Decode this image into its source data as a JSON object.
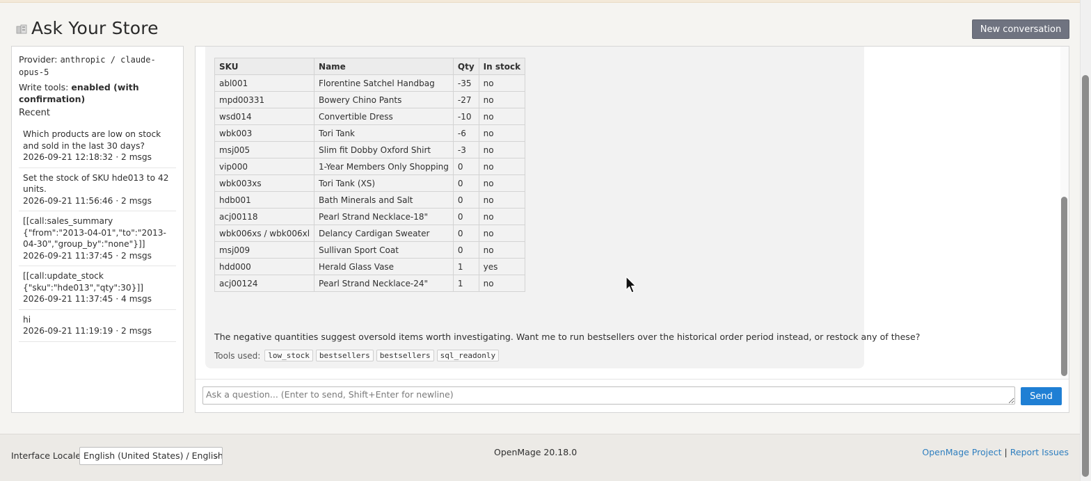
{
  "header": {
    "title": "Ask Your Store",
    "new_conversation_label": "New conversation"
  },
  "sidebar": {
    "provider_label": "Provider:",
    "provider_value": "anthropic / claude-opus-5",
    "write_label": "Write tools:",
    "write_value": "enabled (with confirmation)",
    "recent_heading": "Recent",
    "recent": [
      {
        "question": "Which products are low on stock and sold in the last 30 days?",
        "meta": "2026-09-21 12:18:32 · 2 msgs"
      },
      {
        "question": "Set the stock of SKU hde013 to 42 units.",
        "meta": "2026-09-21 11:56:46 · 2 msgs"
      },
      {
        "question": "[[call:sales_summary {\"from\":\"2013-04-01\",\"to\":\"2013-04-30\",\"group_by\":\"none\"}]]",
        "meta": "2026-09-21 11:37:45 · 2 msgs"
      },
      {
        "question": "[[call:update_stock {\"sku\":\"hde013\",\"qty\":30}]]",
        "meta": "2026-09-21 11:37:45 · 4 msgs"
      },
      {
        "question": "hi",
        "meta": "2026-09-21 11:19:19 · 2 msgs"
      }
    ]
  },
  "chat": {
    "table": {
      "headers": [
        "SKU",
        "Name",
        "Qty",
        "In stock"
      ],
      "rows": [
        [
          "abl001",
          "Florentine Satchel Handbag",
          "-35",
          "no"
        ],
        [
          "mpd00331",
          "Bowery Chino Pants",
          "-27",
          "no"
        ],
        [
          "wsd014",
          "Convertible Dress",
          "-10",
          "no"
        ],
        [
          "wbk003",
          "Tori Tank",
          "-6",
          "no"
        ],
        [
          "msj005",
          "Slim fit Dobby Oxford Shirt",
          "-3",
          "no"
        ],
        [
          "vip000",
          "1-Year Members Only Shopping",
          "0",
          "no"
        ],
        [
          "wbk003xs",
          "Tori Tank (XS)",
          "0",
          "no"
        ],
        [
          "hdb001",
          "Bath Minerals and Salt",
          "0",
          "no"
        ],
        [
          "acj00118",
          "Pearl Strand Necklace-18\"",
          "0",
          "no"
        ],
        [
          "wbk006xs / wbk006xl",
          "Delancy Cardigan Sweater",
          "0",
          "no"
        ],
        [
          "msj009",
          "Sullivan Sport Coat",
          "0",
          "no"
        ],
        [
          "hdd000",
          "Herald Glass Vase",
          "1",
          "yes"
        ],
        [
          "acj00124",
          "Pearl Strand Necklace-24\"",
          "1",
          "no"
        ]
      ]
    },
    "answer": "The negative quantities suggest oversold items worth investigating. Want me to run bestsellers over the historical order period instead, or restock any of these?",
    "tools_label": "Tools used:",
    "tools": [
      "low_stock",
      "bestsellers",
      "bestsellers",
      "sql_readonly"
    ],
    "input_placeholder": "Ask a question... (Enter to send, Shift+Enter for newline)",
    "send_label": "Send"
  },
  "footer": {
    "locale_label": "Interface Locale:",
    "locale_value": "English (United States) / English",
    "version": "OpenMage 20.18.0",
    "link_project": "OpenMage Project",
    "separator": "|",
    "link_issues": "Report Issues"
  }
}
